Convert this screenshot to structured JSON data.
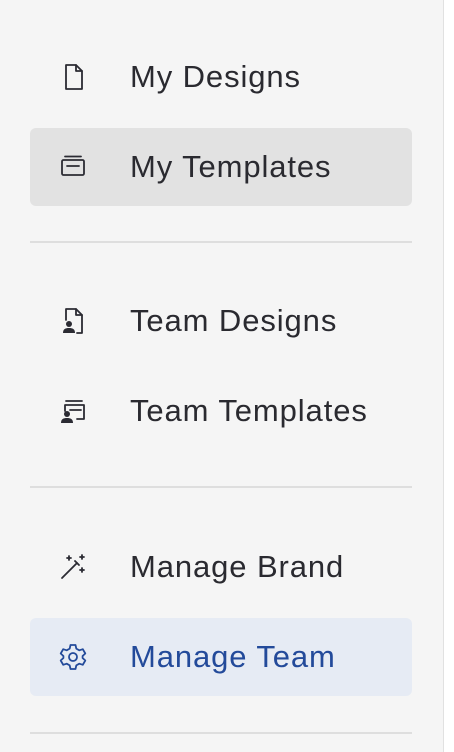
{
  "nav": {
    "my_designs": {
      "label": "My Designs",
      "icon": "document-icon"
    },
    "my_templates": {
      "label": "My Templates",
      "icon": "template-icon",
      "state": "selected"
    },
    "team_designs": {
      "label": "Team Designs",
      "icon": "team-document-icon"
    },
    "team_templates": {
      "label": "Team Templates",
      "icon": "team-template-icon"
    },
    "manage_brand": {
      "label": "Manage Brand",
      "icon": "magic-wand-icon"
    },
    "manage_team": {
      "label": "Manage Team",
      "icon": "gear-icon",
      "state": "active"
    }
  },
  "colors": {
    "sidebar_bg": "#f5f5f5",
    "selected_bg": "#e2e2e2",
    "active_bg": "#e6ebf4",
    "active_text": "#234a9a",
    "text": "#2a2a30"
  }
}
